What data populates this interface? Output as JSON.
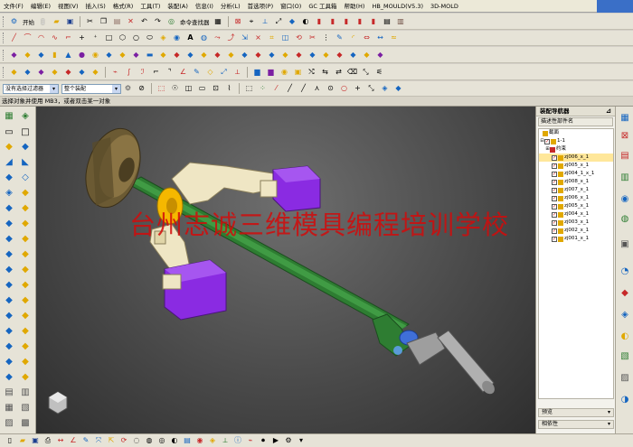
{
  "menu": {
    "items": [
      "文件(F)",
      "编辑(E)",
      "视图(V)",
      "插入(S)",
      "格式(R)",
      "工具(T)",
      "装配(A)",
      "信息(I)",
      "分析(L)",
      "首选项(P)",
      "窗口(O)",
      "GC 工具箱",
      "帮助(H)",
      "HB_MOULD(V5.3)",
      "3D-MOLD"
    ]
  },
  "toolbar1": {
    "start_label": "开始",
    "command_finder_label": "命令查找器"
  },
  "selection_bar": {
    "filter_value": "没有选择过滤器",
    "scope_value": "整个装配"
  },
  "status": {
    "prompt": "选择对象并使用 MB3，或者双击某一对象"
  },
  "viewport": {
    "watermark": "台州志诚三维模具编程培训学校",
    "colors": {
      "shaft": "#2e7d32",
      "clamp": "#8a2be2",
      "arm": "#efe6c4",
      "disk": "#6b5a33",
      "ring": "#f5b800",
      "background": "#4a4a4a"
    }
  },
  "navigator": {
    "title": "装配导航器",
    "column_header": "描述性部件名",
    "sections_label": "截面",
    "root_label": "1-1",
    "constraints_label": "约束",
    "parts": [
      "zj006_x_1",
      "zj005_x_1",
      "zj004_1_x_1",
      "zj008_x_1",
      "zj007_x_1",
      "zj006_x_1",
      "zj005_x_1",
      "zj004_x_1",
      "zj003_x_1",
      "zj002_x_1",
      "zj001_x_1"
    ],
    "preview_label": "预览",
    "dependencies_label": "相依性"
  },
  "icons": {
    "toolbar": [
      "new-file-icon",
      "open-icon",
      "save-icon",
      "cut-icon",
      "copy-icon",
      "paste-icon",
      "undo-icon",
      "redo-icon"
    ],
    "sketch": [
      "line-icon",
      "arc-icon",
      "spline-icon",
      "point-icon",
      "rectangle-icon",
      "polygon-icon",
      "circle-icon",
      "ellipse-icon",
      "text-icon"
    ]
  }
}
